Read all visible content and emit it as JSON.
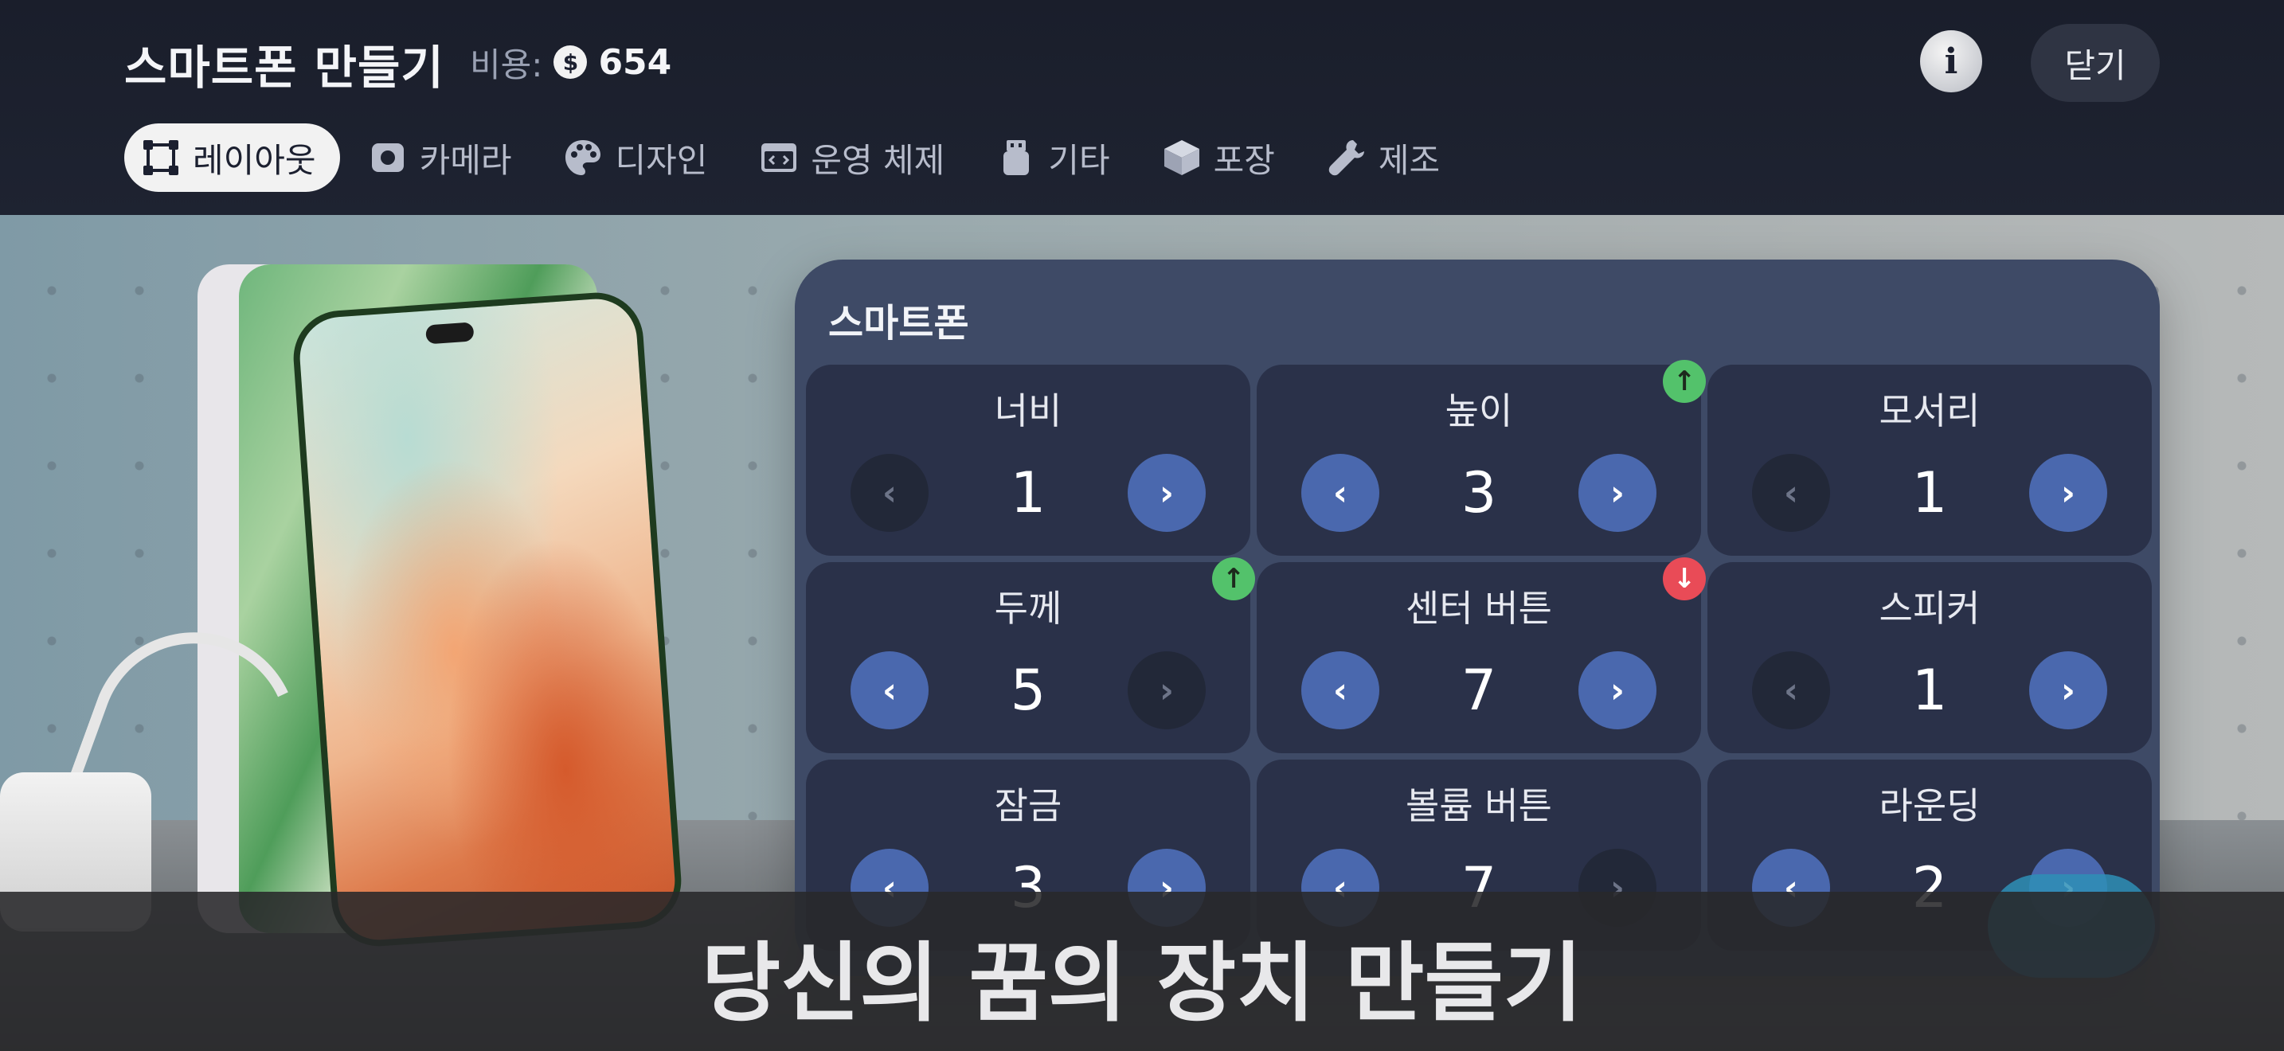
{
  "header": {
    "title": "스마트폰 만들기",
    "cost_label": "비용:",
    "coin_symbol": "$",
    "cost_value": "654",
    "info_symbol": "i",
    "close_label": "닫기"
  },
  "tabs": [
    {
      "label": "레이아웃",
      "icon": "layout-icon",
      "active": true
    },
    {
      "label": "카메라",
      "icon": "camera-icon",
      "active": false
    },
    {
      "label": "디자인",
      "icon": "palette-icon",
      "active": false
    },
    {
      "label": "운영 체제",
      "icon": "code-window-icon",
      "active": false
    },
    {
      "label": "기타",
      "icon": "usb-drive-icon",
      "active": false
    },
    {
      "label": "포장",
      "icon": "box-icon",
      "active": false
    },
    {
      "label": "제조",
      "icon": "wrench-icon",
      "active": false
    }
  ],
  "panel": {
    "title": "스마트폰",
    "cells": [
      {
        "label": "너비",
        "value": "1",
        "prev_enabled": false,
        "next_enabled": true,
        "badge": null
      },
      {
        "label": "높이",
        "value": "3",
        "prev_enabled": true,
        "next_enabled": true,
        "badge": "up"
      },
      {
        "label": "모서리",
        "value": "1",
        "prev_enabled": false,
        "next_enabled": true,
        "badge": null
      },
      {
        "label": "두께",
        "value": "5",
        "prev_enabled": true,
        "next_enabled": false,
        "badge": "up"
      },
      {
        "label": "센터 버튼",
        "value": "7",
        "prev_enabled": true,
        "next_enabled": true,
        "badge": "down"
      },
      {
        "label": "스피커",
        "value": "1",
        "prev_enabled": false,
        "next_enabled": true,
        "badge": null
      },
      {
        "label": "잠금",
        "value": "3",
        "prev_enabled": true,
        "next_enabled": true,
        "badge": null
      },
      {
        "label": "볼륨 버튼",
        "value": "7",
        "prev_enabled": true,
        "next_enabled": false,
        "badge": null
      },
      {
        "label": "라운딩",
        "value": "2",
        "prev_enabled": true,
        "next_enabled": true,
        "badge": null
      }
    ],
    "arrow_prev": "‹",
    "arrow_next": "›",
    "badge_up": "↑",
    "badge_down": "↓"
  },
  "caption": "당신의 꿈의 장치 만들기",
  "colors": {
    "accent": "#4a68ae",
    "badge_up": "#53c26b",
    "badge_down": "#e94b57",
    "panel": "#3e4a66"
  }
}
